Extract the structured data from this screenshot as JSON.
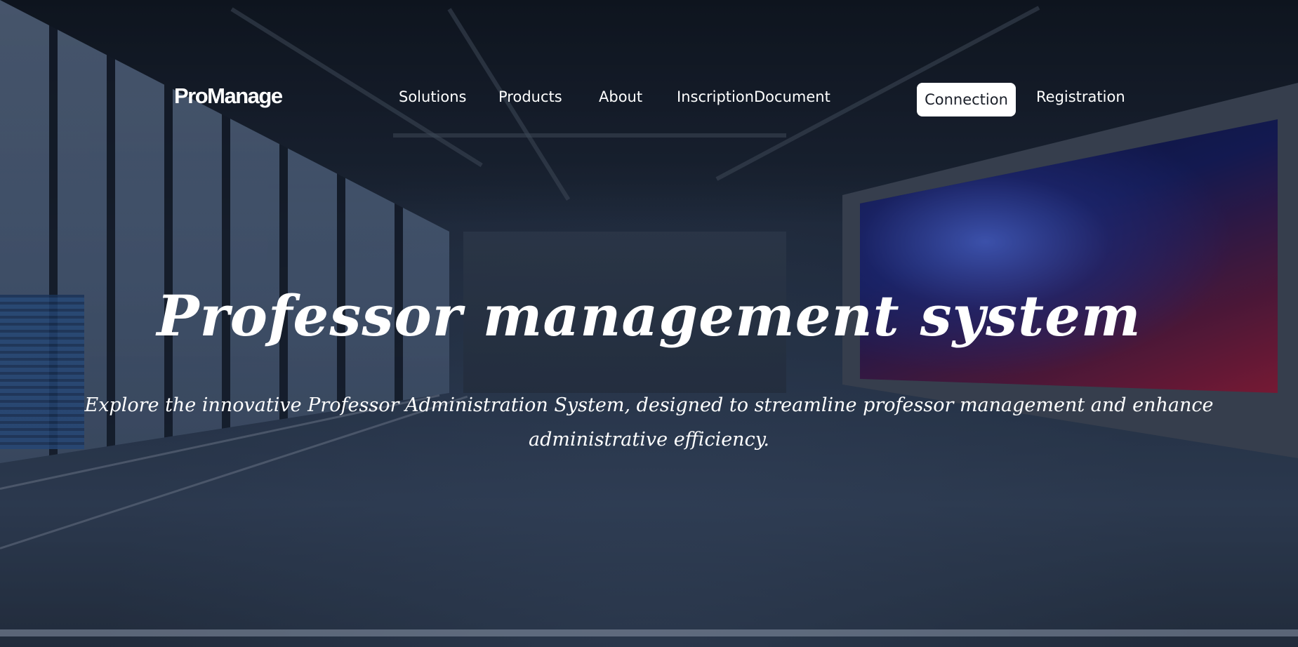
{
  "nav": {
    "logo": "ProManage",
    "links": [
      "Solutions",
      "Products",
      "About",
      "InscriptionDocument"
    ],
    "connection_label": "Connection",
    "registration_label": "Registration"
  },
  "hero": {
    "title": "Professor management system",
    "subtitle": "Explore the innovative Professor Administration System, designed to streamline professor management and enhance administrative efficiency."
  }
}
